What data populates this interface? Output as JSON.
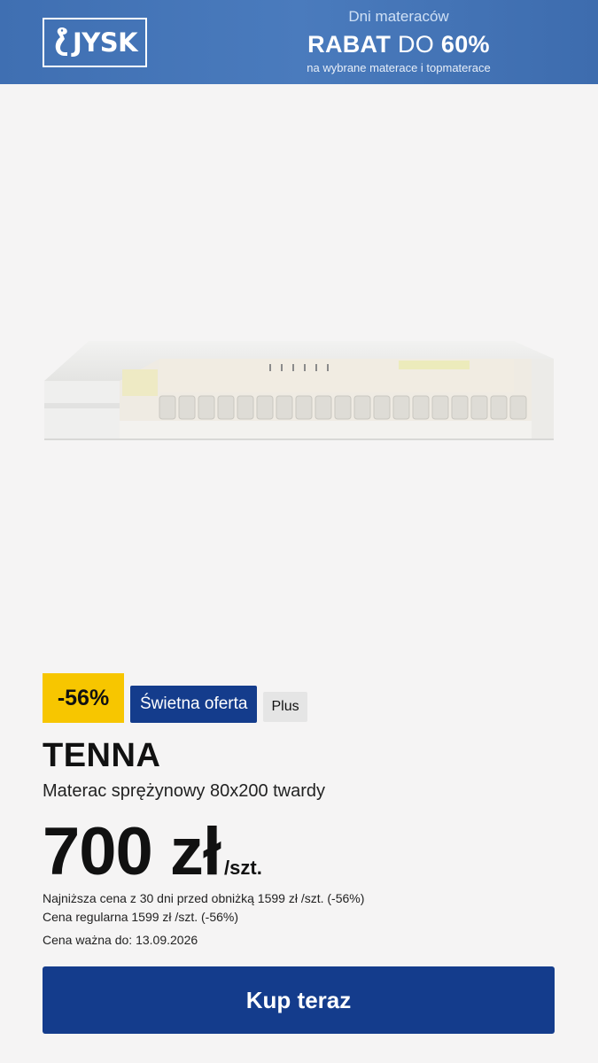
{
  "banner": {
    "logo_text": "JYSK",
    "kicker": "Dni materaców",
    "headline_bold1": "RABAT",
    "headline_regular": "DO",
    "headline_bold2": "60%",
    "subline": "na wybrane materace i topmaterace"
  },
  "product": {
    "image_label": "mattress-image",
    "badges": {
      "discount": "-56%",
      "offer": "Świetna oferta",
      "plus": "Plus"
    },
    "name": "TENNA",
    "description": "Materac sprężynowy 80x200 twardy",
    "price_value": "700 zł",
    "price_unit": "/szt.",
    "lowest_price_note": "Najniższa cena z 30 dni przed obniżką 1599 zł /szt. (-56%)",
    "regular_price_note": "Cena regularna 1599 zł /szt. (-56%)",
    "valid_until": "Cena ważna do: 13.09.2026"
  },
  "cta": {
    "buy_label": "Kup teraz"
  },
  "colors": {
    "banner": "#4a7bbd",
    "discount_badge": "#f7c600",
    "primary_blue": "#143c8c",
    "plus_badge": "#e5e5e5",
    "background": "#f5f4f4"
  }
}
